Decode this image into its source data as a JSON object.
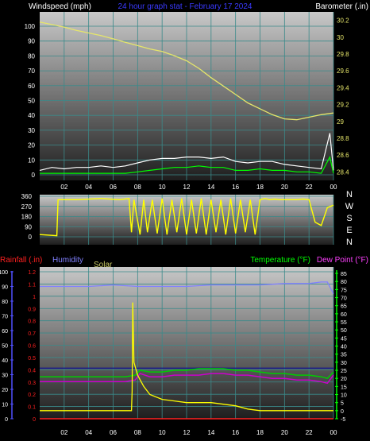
{
  "header": {
    "left_title": "Windspeed (mph)",
    "center_title": "24 hour graph stat - February 17 2024",
    "right_title": "Barometer (.in)"
  },
  "colors": {
    "background": "#000000",
    "plot_gradient_top": "#c8c8c8",
    "plot_gradient_bottom": "#1e1e1e",
    "grid": "#3a8a8a",
    "barometer": "#e6e66a",
    "wind_gust": "#ffffff",
    "wind_avg": "#00ff00",
    "wind_dir": "#ffff00",
    "rainfall": "#ff2020",
    "humidity": "#8080ff",
    "solar": "#c8c864",
    "temperature": "#00cc00",
    "dewpoint": "#cc00cc",
    "temp_axis": "#00ff00",
    "humidity_axis": "#5050ff"
  },
  "chart_data": [
    {
      "type": "line",
      "name_key": "wind_baro",
      "x_ticks": [
        "02",
        "04",
        "06",
        "08",
        "10",
        "12",
        "14",
        "16",
        "18",
        "20",
        "22",
        "00"
      ],
      "left_axis": {
        "label": "Windspeed (mph)",
        "ticks": [
          "0",
          "10",
          "20",
          "30",
          "40",
          "50",
          "60",
          "70",
          "80",
          "90",
          "100"
        ],
        "ylim": [
          0,
          100
        ]
      },
      "right_axis": {
        "label": "Barometer (.in)",
        "ticks": [
          "28.4",
          "28.6",
          "28.8",
          "29",
          "29.2",
          "29.4",
          "29.6",
          "29.8",
          "30",
          "30.2"
        ],
        "ylim": [
          28.3,
          30.3
        ]
      },
      "barometer": {
        "x": [
          0,
          1,
          2,
          3,
          4,
          5,
          6,
          7,
          8,
          9,
          10,
          11,
          12,
          13,
          14,
          15,
          16,
          17,
          18,
          19,
          20,
          21,
          22,
          23,
          24
        ],
        "values": [
          30.18,
          30.15,
          30.12,
          30.08,
          30.05,
          30.02,
          29.98,
          29.94,
          29.9,
          29.86,
          29.83,
          29.78,
          29.72,
          29.63,
          29.52,
          29.42,
          29.32,
          29.22,
          29.15,
          29.08,
          29.03,
          29.02,
          29.05,
          29.08,
          29.1
        ]
      },
      "wind_gust": {
        "x": [
          0,
          1,
          2,
          3,
          4,
          5,
          6,
          7,
          8,
          9,
          10,
          11,
          12,
          13,
          14,
          15,
          16,
          17,
          18,
          19,
          20,
          21,
          22,
          23,
          23.7,
          24
        ],
        "values": [
          3,
          5,
          4,
          5,
          5,
          6,
          5,
          6,
          8,
          10,
          11,
          11,
          12,
          12,
          11,
          12,
          9,
          8,
          9,
          9,
          7,
          6,
          5,
          4,
          28,
          3
        ]
      },
      "wind_avg": {
        "x": [
          0,
          2,
          4,
          6,
          7,
          8,
          9,
          10,
          11,
          12,
          13,
          14,
          15,
          16,
          17,
          18,
          19,
          20,
          21,
          22,
          23,
          23.7,
          24
        ],
        "values": [
          1,
          1,
          1,
          1,
          1,
          2,
          3,
          4,
          5,
          5,
          6,
          5,
          5,
          3,
          3,
          4,
          3,
          3,
          2,
          2,
          1,
          12,
          1
        ]
      }
    },
    {
      "type": "line",
      "name_key": "wind_direction",
      "x_ticks": [
        "02",
        "04",
        "06",
        "08",
        "10",
        "12",
        "14",
        "16",
        "18",
        "20",
        "22",
        "00"
      ],
      "left_axis": {
        "ticks": [
          "0",
          "90",
          "180",
          "270",
          "360"
        ],
        "ylim": [
          0,
          360
        ]
      },
      "compass": [
        "N",
        "W",
        "S",
        "E",
        "N"
      ],
      "wind_dir": {
        "x": [
          0,
          1.4,
          1.5,
          3,
          5,
          6.5,
          7.3,
          7.5,
          7.7,
          8.2,
          8.5,
          8.8,
          9.2,
          9.6,
          10,
          10.4,
          10.8,
          11.2,
          11.6,
          12,
          12.4,
          12.8,
          13.2,
          13.6,
          14,
          14.4,
          14.8,
          15.2,
          15.6,
          16,
          16.4,
          16.8,
          17.2,
          17.6,
          18,
          18.4,
          18.8,
          19.2,
          19.6,
          20,
          21,
          21.5,
          22,
          22.5,
          23,
          23.5,
          24
        ],
        "values": [
          20,
          10,
          330,
          330,
          340,
          330,
          340,
          40,
          330,
          20,
          330,
          40,
          330,
          30,
          340,
          20,
          330,
          40,
          340,
          20,
          330,
          30,
          340,
          20,
          330,
          40,
          330,
          20,
          340,
          30,
          330,
          40,
          330,
          20,
          330,
          340,
          330,
          335,
          330,
          330,
          330,
          335,
          330,
          130,
          100,
          260,
          280
        ]
      }
    },
    {
      "type": "line",
      "name_key": "rain_temp",
      "x_ticks": [
        "02",
        "04",
        "06",
        "08",
        "10",
        "12",
        "14",
        "16",
        "18",
        "20",
        "22",
        "00"
      ],
      "header": {
        "rainfall": "Rainfall (.in)",
        "humidity": "Humidity",
        "solar": "Solar",
        "temperature": "Temperature (°F)",
        "dewpoint": "Dew Point (°F)"
      },
      "humidity_axis": {
        "ticks": [
          "0",
          "10",
          "20",
          "30",
          "40",
          "50",
          "60",
          "70",
          "80",
          "90",
          "100"
        ],
        "ylim": [
          0,
          100
        ]
      },
      "rain_axis": {
        "ticks": [
          "0",
          "0.1",
          "0.2",
          "0.3",
          "0.4",
          "0.5",
          "0.6",
          "0.7",
          "0.8",
          "0.9",
          "1",
          "1.1",
          "1.2"
        ],
        "ylim": [
          0,
          1.2
        ]
      },
      "temp_axis": {
        "ticks": [
          "-5",
          "0",
          "5",
          "10",
          "15",
          "20",
          "25",
          "30",
          "35",
          "40",
          "45",
          "50",
          "55",
          "60",
          "65",
          "70",
          "75",
          "80",
          "85"
        ],
        "ylim": [
          -5,
          87
        ]
      },
      "humidity": {
        "x": [
          0,
          4,
          6,
          8,
          10,
          12,
          14,
          16,
          18,
          20,
          22,
          23,
          23.5,
          24
        ],
        "values": [
          90,
          90,
          91,
          90,
          90,
          90,
          91,
          91,
          91,
          92,
          92,
          93,
          93,
          85
        ]
      },
      "temperature": {
        "x": [
          0,
          2,
          4,
          6,
          7,
          7.8,
          8.2,
          9,
          10,
          11,
          12,
          13,
          14,
          15,
          16,
          17,
          18,
          19,
          20,
          21,
          22,
          23,
          23.5,
          24
        ],
        "values": [
          21,
          21,
          21,
          21,
          21,
          22,
          25,
          24,
          24,
          25,
          25,
          26,
          26,
          26,
          25,
          25,
          24,
          23,
          23,
          22,
          22,
          21,
          20,
          24
        ]
      },
      "dewpoint": {
        "x": [
          0,
          2,
          4,
          6,
          7,
          7.8,
          8.2,
          9,
          10,
          11,
          12,
          13,
          14,
          15,
          16,
          17,
          18,
          19,
          20,
          21,
          22,
          23,
          23.5,
          24
        ],
        "values": [
          18,
          18,
          18,
          18,
          18,
          19,
          23,
          21,
          21,
          22,
          22,
          22,
          23,
          23,
          22,
          22,
          21,
          20,
          20,
          19,
          19,
          18,
          17,
          22
        ]
      },
      "solar": {
        "x": [
          0,
          7.5,
          7.55,
          7.6,
          7.7,
          8,
          8.5,
          9,
          10,
          11,
          12,
          13,
          14,
          15,
          16,
          17,
          18,
          24
        ],
        "values": [
          0,
          0,
          12,
          67,
          30,
          22,
          15,
          10,
          7,
          6,
          5,
          5,
          5,
          4,
          3,
          1,
          0,
          0
        ]
      },
      "rainfall": {
        "x": [
          0,
          24
        ],
        "values": [
          0,
          0
        ]
      }
    }
  ]
}
